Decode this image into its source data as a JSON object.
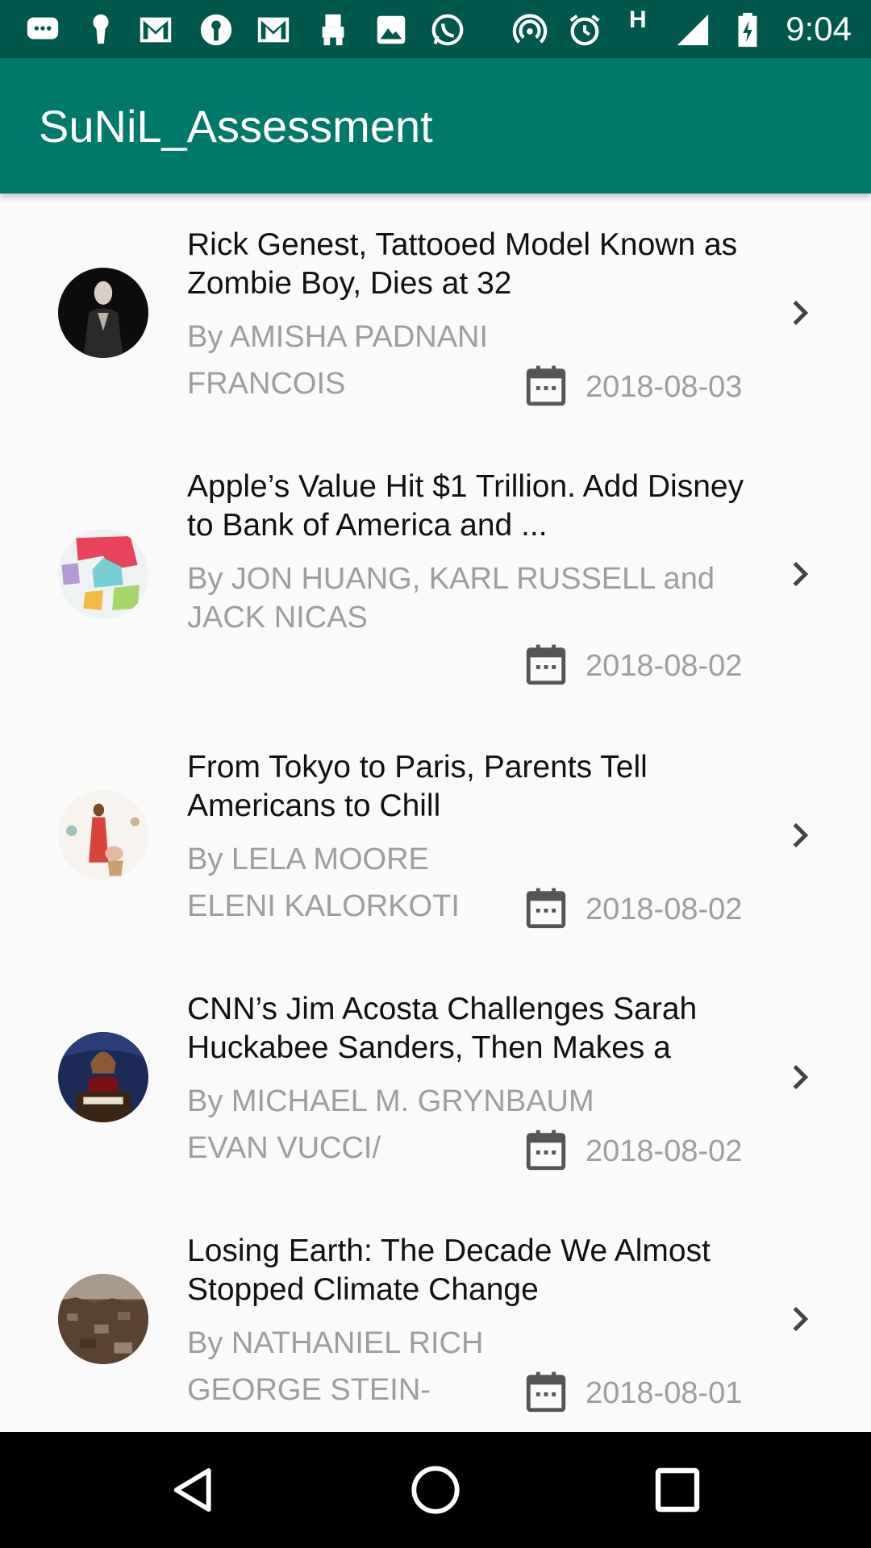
{
  "status_bar": {
    "time": "9:04",
    "icons": [
      "messages-icon",
      "keyhole-icon",
      "gmail-icon",
      "keyhole-icon",
      "gmail-icon",
      "robot-icon",
      "photos-icon",
      "whatsapp-icon",
      "hotspot-icon",
      "alarm-icon",
      "h-network-icon",
      "signal-icon",
      "battery-charging-icon"
    ],
    "network_label": "H"
  },
  "app_bar": {
    "title": "SuNiL_Assessment"
  },
  "articles": [
    {
      "title": "Rick Genest, Tattooed Model Known as Zombie Boy, Dies at 32",
      "byline": "By AMISHA PADNANI",
      "credit": "FRANCOIS",
      "date": "2018-08-03"
    },
    {
      "title": "Apple’s Value Hit $1 Trillion. Add Disney to Bank of America and ...",
      "byline": "By JON HUANG, KARL RUSSELL and JACK NICAS",
      "credit": "",
      "date": "2018-08-02"
    },
    {
      "title": "From Tokyo to Paris, Parents Tell Americans to Chill",
      "byline": "By LELA MOORE",
      "credit": "ELENI KALORKOTI",
      "date": "2018-08-02"
    },
    {
      "title": "CNN’s Jim Acosta Challenges Sarah Huckabee Sanders, Then Makes a",
      "byline": "By MICHAEL M. GRYNBAUM",
      "credit": "EVAN VUCCI/",
      "date": "2018-08-02"
    },
    {
      "title": "Losing Earth: The Decade We Almost Stopped Climate Change",
      "byline": "By NATHANIEL RICH",
      "credit": "GEORGE STEIN-",
      "date": "2018-08-01"
    }
  ],
  "nav_bar": {
    "back": "back-icon",
    "home": "home-icon",
    "recents": "recents-icon"
  },
  "colors": {
    "status_bar": "#00574b",
    "app_bar": "#00796b",
    "title_text": "#111111",
    "secondary_text": "#9e9e9e",
    "background": "#fafafa"
  }
}
